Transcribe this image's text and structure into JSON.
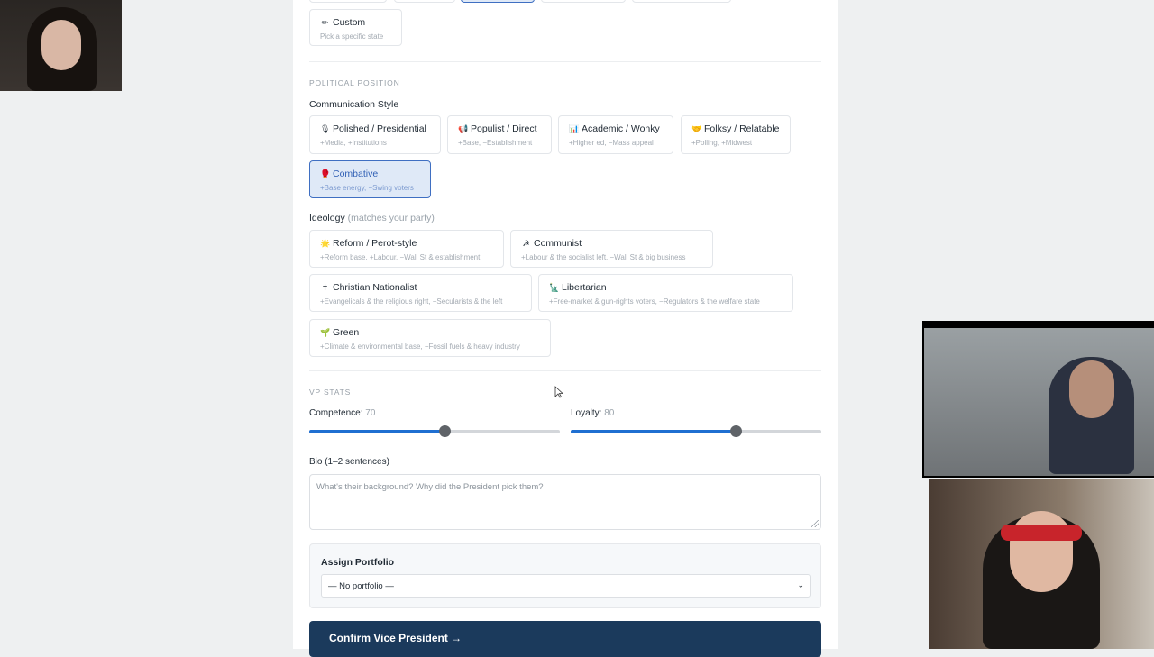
{
  "custom_option": {
    "icon": "✏",
    "title": "Custom",
    "sub": "Pick a specific state"
  },
  "political_position": {
    "section_label": "POLITICAL POSITION",
    "communication_style": {
      "label": "Communication Style",
      "options": [
        {
          "icon": "🎙",
          "title": "Polished / Presidential",
          "sub": "+Media, +Institutions"
        },
        {
          "icon": "📢",
          "title": "Populist / Direct",
          "sub": "+Base, −Establishment"
        },
        {
          "icon": "📊",
          "title": "Academic / Wonky",
          "sub": "+Higher ed, −Mass appeal"
        },
        {
          "icon": "🤝",
          "title": "Folksy / Relatable",
          "sub": "+Polling, +Midwest"
        },
        {
          "icon": "🥊",
          "title": "Combative",
          "sub": "+Base energy, −Swing voters",
          "selected": true
        }
      ]
    },
    "ideology": {
      "label": "Ideology",
      "hint": "(matches your party)",
      "options": [
        {
          "icon": "🌟",
          "title": "Reform / Perot-style",
          "sub": "+Reform base, +Labour, −Wall St & establishment"
        },
        {
          "icon": "☭",
          "title": "Communist",
          "sub": "+Labour & the socialist left, −Wall St & big business"
        },
        {
          "icon": "✝",
          "title": "Christian Nationalist",
          "sub": "+Evangelicals & the religious right, −Secularists & the left"
        },
        {
          "icon": "🗽",
          "title": "Libertarian",
          "sub": "+Free-market & gun-rights voters, −Regulators & the welfare state"
        },
        {
          "icon": "🌱",
          "title": "Green",
          "sub": "+Climate & environmental base, −Fossil fuels & heavy industry"
        }
      ]
    }
  },
  "vp_stats": {
    "section_label": "VP STATS",
    "competence": {
      "label": "Competence:",
      "value": "70",
      "fraction": 0.54
    },
    "loyalty": {
      "label": "Loyalty:",
      "value": "80",
      "fraction": 0.66
    }
  },
  "bio": {
    "label": "Bio (1–2 sentences)",
    "placeholder": "What's their background? Why did the President pick them?"
  },
  "portfolio": {
    "label": "Assign Portfolio",
    "selected": "— No portfolio —"
  },
  "confirm_label": "Confirm Vice President →",
  "colors": {
    "accent": "#1f6fd1",
    "confirm_bg": "#1b3a5c",
    "selected_bg": "#dfe9f7"
  }
}
